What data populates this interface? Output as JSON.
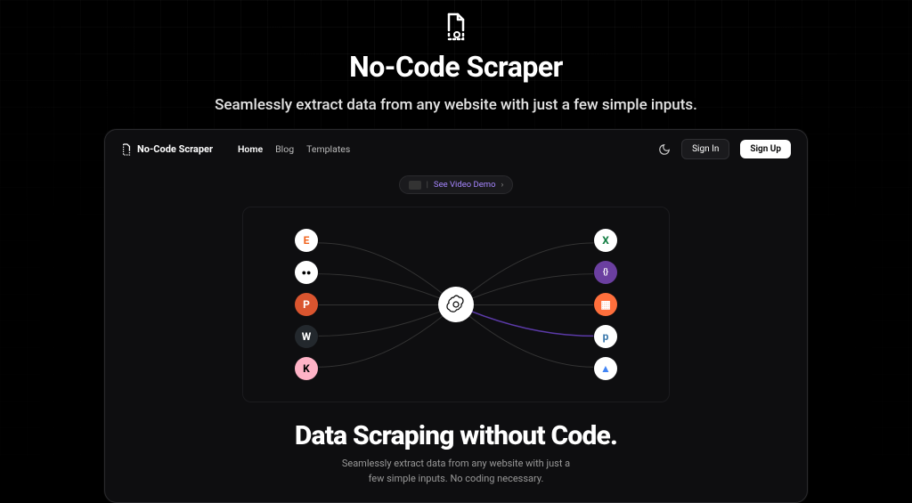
{
  "hero": {
    "title": "No-Code Scraper",
    "subtitle": "Seamlessly extract data from any website with just a few simple inputs."
  },
  "mockup": {
    "brand": "No-Code Scraper",
    "nav": {
      "home": "Home",
      "blog": "Blog",
      "templates": "Templates"
    },
    "signin": "Sign In",
    "signup": "Sign Up",
    "demo_label": "See Video Demo",
    "demo_chevron": "›",
    "hero_title": "Data Scraping without Code.",
    "hero_sub1": "Seamlessly extract data from any website with just a",
    "hero_sub2": "few simple inputs. No coding necessary."
  },
  "nodes": {
    "left": [
      {
        "name": "etsy",
        "glyph": "E",
        "bg": "#ffffff",
        "fg": "#f1641e"
      },
      {
        "name": "medium",
        "glyph": "●●",
        "bg": "#ffffff",
        "fg": "#000000"
      },
      {
        "name": "producthunt",
        "glyph": "P",
        "bg": "#da552f",
        "fg": "#ffffff"
      },
      {
        "name": "wordpress",
        "glyph": "W",
        "bg": "#23282d",
        "fg": "#ffffff"
      },
      {
        "name": "klarna",
        "glyph": "K",
        "bg": "#ffb3c7",
        "fg": "#000000"
      }
    ],
    "right": [
      {
        "name": "excel",
        "glyph": "X",
        "bg": "#ffffff",
        "fg": "#107c41"
      },
      {
        "name": "json",
        "glyph": "{}",
        "bg": "#6b3fa0",
        "fg": "#ffffff"
      },
      {
        "name": "sheets",
        "glyph": "▦",
        "bg": "#ff6f3c",
        "fg": "#ffffff"
      },
      {
        "name": "python",
        "glyph": "p",
        "bg": "#ffffff",
        "fg": "#3776ab"
      },
      {
        "name": "drive",
        "glyph": "▲",
        "bg": "#ffffff",
        "fg": "#4285f4"
      }
    ]
  }
}
